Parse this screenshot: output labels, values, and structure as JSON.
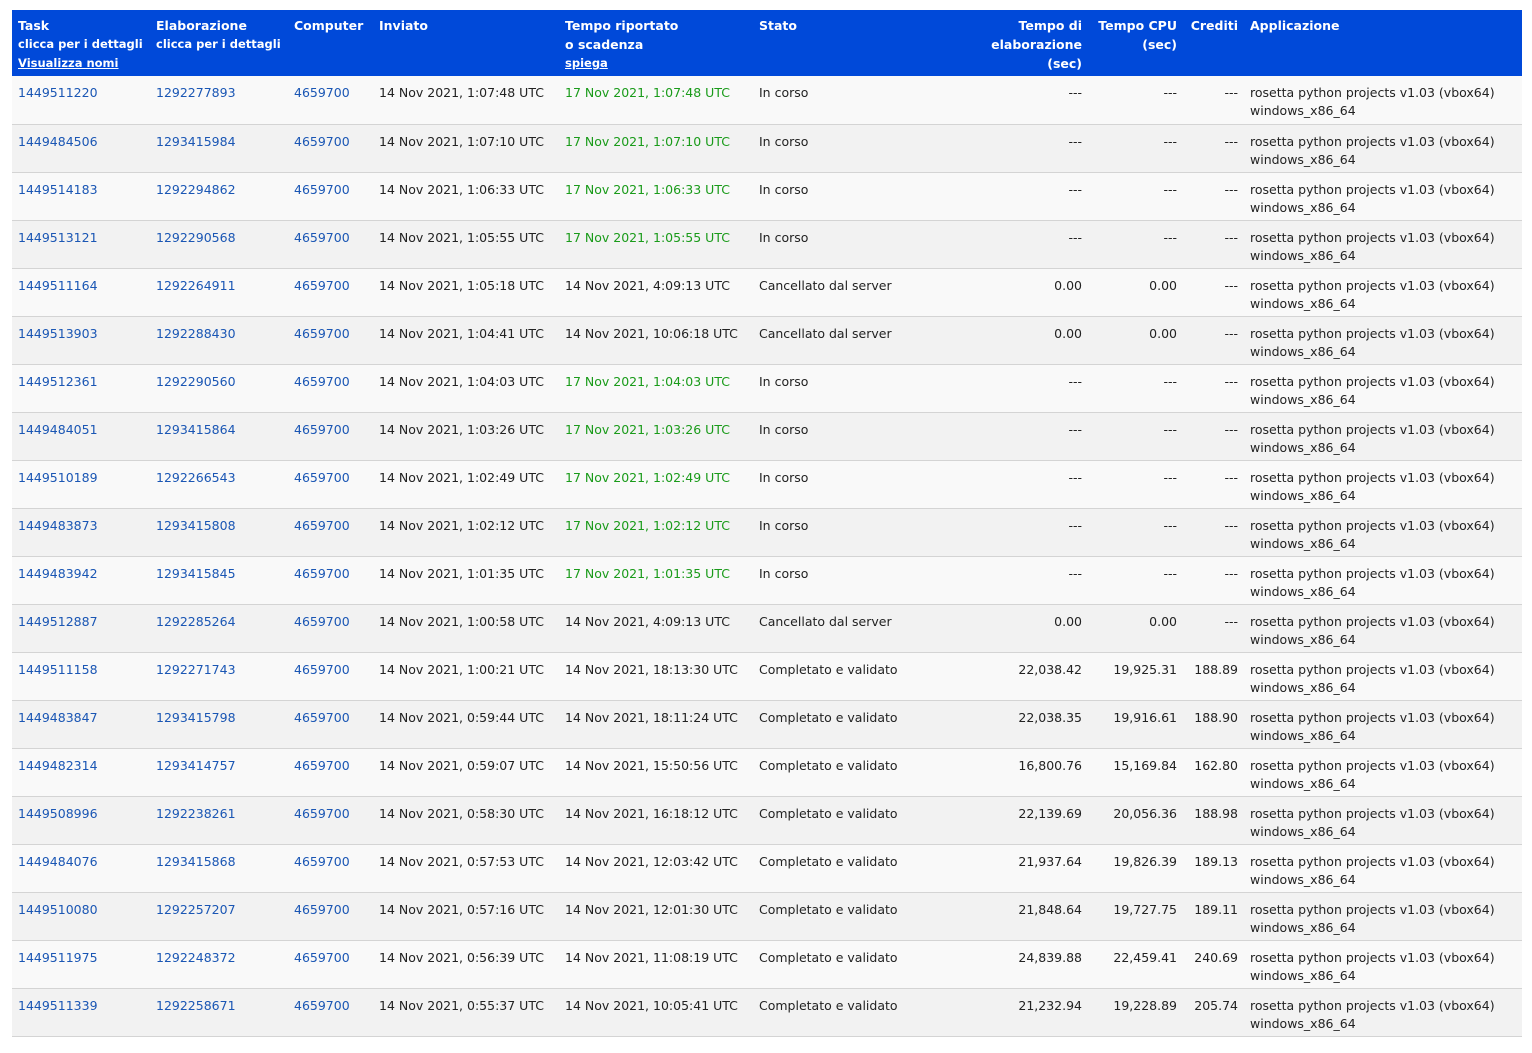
{
  "header": {
    "task": "Task",
    "task_sub": "clicca per i dettagli",
    "task_link": "Visualizza nomi",
    "wu": "Elaborazione",
    "wu_sub": "clicca per i dettagli",
    "computer": "Computer",
    "sent": "Inviato",
    "reported": "Tempo riportato",
    "reported_sub": "o scadenza",
    "reported_link": "spiega",
    "status": "Stato",
    "run_time": "Tempo di elaborazione",
    "run_time_unit": "(sec)",
    "cpu_time": "Tempo CPU",
    "cpu_time_unit": "(sec)",
    "credit": "Crediti",
    "application": "Applicazione"
  },
  "colors": {
    "header_bg": "#0049d9",
    "link": "#1a56b4",
    "in_progress": "#1a9b1a"
  },
  "rows": [
    {
      "task": "1449511220",
      "wu": "1292277893",
      "computer": "4659700",
      "sent": "14 Nov 2021, 1:07:48 UTC",
      "reported": "17 Nov 2021, 1:07:48 UTC",
      "deadline": true,
      "status": "In corso",
      "run": "---",
      "cpu": "---",
      "credit": "---",
      "app": "rosetta python projects v1.03 (vbox64)",
      "platform": "windows_x86_64"
    },
    {
      "task": "1449484506",
      "wu": "1293415984",
      "computer": "4659700",
      "sent": "14 Nov 2021, 1:07:10 UTC",
      "reported": "17 Nov 2021, 1:07:10 UTC",
      "deadline": true,
      "status": "In corso",
      "run": "---",
      "cpu": "---",
      "credit": "---",
      "app": "rosetta python projects v1.03 (vbox64)",
      "platform": "windows_x86_64"
    },
    {
      "task": "1449514183",
      "wu": "1292294862",
      "computer": "4659700",
      "sent": "14 Nov 2021, 1:06:33 UTC",
      "reported": "17 Nov 2021, 1:06:33 UTC",
      "deadline": true,
      "status": "In corso",
      "run": "---",
      "cpu": "---",
      "credit": "---",
      "app": "rosetta python projects v1.03 (vbox64)",
      "platform": "windows_x86_64"
    },
    {
      "task": "1449513121",
      "wu": "1292290568",
      "computer": "4659700",
      "sent": "14 Nov 2021, 1:05:55 UTC",
      "reported": "17 Nov 2021, 1:05:55 UTC",
      "deadline": true,
      "status": "In corso",
      "run": "---",
      "cpu": "---",
      "credit": "---",
      "app": "rosetta python projects v1.03 (vbox64)",
      "platform": "windows_x86_64"
    },
    {
      "task": "1449511164",
      "wu": "1292264911",
      "computer": "4659700",
      "sent": "14 Nov 2021, 1:05:18 UTC",
      "reported": "14 Nov 2021, 4:09:13 UTC",
      "deadline": false,
      "status": "Cancellato dal server",
      "run": "0.00",
      "cpu": "0.00",
      "credit": "---",
      "app": "rosetta python projects v1.03 (vbox64)",
      "platform": "windows_x86_64"
    },
    {
      "task": "1449513903",
      "wu": "1292288430",
      "computer": "4659700",
      "sent": "14 Nov 2021, 1:04:41 UTC",
      "reported": "14 Nov 2021, 10:06:18 UTC",
      "deadline": false,
      "status": "Cancellato dal server",
      "run": "0.00",
      "cpu": "0.00",
      "credit": "---",
      "app": "rosetta python projects v1.03 (vbox64)",
      "platform": "windows_x86_64"
    },
    {
      "task": "1449512361",
      "wu": "1292290560",
      "computer": "4659700",
      "sent": "14 Nov 2021, 1:04:03 UTC",
      "reported": "17 Nov 2021, 1:04:03 UTC",
      "deadline": true,
      "status": "In corso",
      "run": "---",
      "cpu": "---",
      "credit": "---",
      "app": "rosetta python projects v1.03 (vbox64)",
      "platform": "windows_x86_64"
    },
    {
      "task": "1449484051",
      "wu": "1293415864",
      "computer": "4659700",
      "sent": "14 Nov 2021, 1:03:26 UTC",
      "reported": "17 Nov 2021, 1:03:26 UTC",
      "deadline": true,
      "status": "In corso",
      "run": "---",
      "cpu": "---",
      "credit": "---",
      "app": "rosetta python projects v1.03 (vbox64)",
      "platform": "windows_x86_64"
    },
    {
      "task": "1449510189",
      "wu": "1292266543",
      "computer": "4659700",
      "sent": "14 Nov 2021, 1:02:49 UTC",
      "reported": "17 Nov 2021, 1:02:49 UTC",
      "deadline": true,
      "status": "In corso",
      "run": "---",
      "cpu": "---",
      "credit": "---",
      "app": "rosetta python projects v1.03 (vbox64)",
      "platform": "windows_x86_64"
    },
    {
      "task": "1449483873",
      "wu": "1293415808",
      "computer": "4659700",
      "sent": "14 Nov 2021, 1:02:12 UTC",
      "reported": "17 Nov 2021, 1:02:12 UTC",
      "deadline": true,
      "status": "In corso",
      "run": "---",
      "cpu": "---",
      "credit": "---",
      "app": "rosetta python projects v1.03 (vbox64)",
      "platform": "windows_x86_64"
    },
    {
      "task": "1449483942",
      "wu": "1293415845",
      "computer": "4659700",
      "sent": "14 Nov 2021, 1:01:35 UTC",
      "reported": "17 Nov 2021, 1:01:35 UTC",
      "deadline": true,
      "status": "In corso",
      "run": "---",
      "cpu": "---",
      "credit": "---",
      "app": "rosetta python projects v1.03 (vbox64)",
      "platform": "windows_x86_64"
    },
    {
      "task": "1449512887",
      "wu": "1292285264",
      "computer": "4659700",
      "sent": "14 Nov 2021, 1:00:58 UTC",
      "reported": "14 Nov 2021, 4:09:13 UTC",
      "deadline": false,
      "status": "Cancellato dal server",
      "run": "0.00",
      "cpu": "0.00",
      "credit": "---",
      "app": "rosetta python projects v1.03 (vbox64)",
      "platform": "windows_x86_64"
    },
    {
      "task": "1449511158",
      "wu": "1292271743",
      "computer": "4659700",
      "sent": "14 Nov 2021, 1:00:21 UTC",
      "reported": "14 Nov 2021, 18:13:30 UTC",
      "deadline": false,
      "status": "Completato e validato",
      "run": "22,038.42",
      "cpu": "19,925.31",
      "credit": "188.89",
      "app": "rosetta python projects v1.03 (vbox64)",
      "platform": "windows_x86_64"
    },
    {
      "task": "1449483847",
      "wu": "1293415798",
      "computer": "4659700",
      "sent": "14 Nov 2021, 0:59:44 UTC",
      "reported": "14 Nov 2021, 18:11:24 UTC",
      "deadline": false,
      "status": "Completato e validato",
      "run": "22,038.35",
      "cpu": "19,916.61",
      "credit": "188.90",
      "app": "rosetta python projects v1.03 (vbox64)",
      "platform": "windows_x86_64"
    },
    {
      "task": "1449482314",
      "wu": "1293414757",
      "computer": "4659700",
      "sent": "14 Nov 2021, 0:59:07 UTC",
      "reported": "14 Nov 2021, 15:50:56 UTC",
      "deadline": false,
      "status": "Completato e validato",
      "run": "16,800.76",
      "cpu": "15,169.84",
      "credit": "162.80",
      "app": "rosetta python projects v1.03 (vbox64)",
      "platform": "windows_x86_64"
    },
    {
      "task": "1449508996",
      "wu": "1292238261",
      "computer": "4659700",
      "sent": "14 Nov 2021, 0:58:30 UTC",
      "reported": "14 Nov 2021, 16:18:12 UTC",
      "deadline": false,
      "status": "Completato e validato",
      "run": "22,139.69",
      "cpu": "20,056.36",
      "credit": "188.98",
      "app": "rosetta python projects v1.03 (vbox64)",
      "platform": "windows_x86_64"
    },
    {
      "task": "1449484076",
      "wu": "1293415868",
      "computer": "4659700",
      "sent": "14 Nov 2021, 0:57:53 UTC",
      "reported": "14 Nov 2021, 12:03:42 UTC",
      "deadline": false,
      "status": "Completato e validato",
      "run": "21,937.64",
      "cpu": "19,826.39",
      "credit": "189.13",
      "app": "rosetta python projects v1.03 (vbox64)",
      "platform": "windows_x86_64"
    },
    {
      "task": "1449510080",
      "wu": "1292257207",
      "computer": "4659700",
      "sent": "14 Nov 2021, 0:57:16 UTC",
      "reported": "14 Nov 2021, 12:01:30 UTC",
      "deadline": false,
      "status": "Completato e validato",
      "run": "21,848.64",
      "cpu": "19,727.75",
      "credit": "189.11",
      "app": "rosetta python projects v1.03 (vbox64)",
      "platform": "windows_x86_64"
    },
    {
      "task": "1449511975",
      "wu": "1292248372",
      "computer": "4659700",
      "sent": "14 Nov 2021, 0:56:39 UTC",
      "reported": "14 Nov 2021, 11:08:19 UTC",
      "deadline": false,
      "status": "Completato e validato",
      "run": "24,839.88",
      "cpu": "22,459.41",
      "credit": "240.69",
      "app": "rosetta python projects v1.03 (vbox64)",
      "platform": "windows_x86_64"
    },
    {
      "task": "1449511339",
      "wu": "1292258671",
      "computer": "4659700",
      "sent": "14 Nov 2021, 0:55:37 UTC",
      "reported": "14 Nov 2021, 10:05:41 UTC",
      "deadline": false,
      "status": "Completato e validato",
      "run": "21,232.94",
      "cpu": "19,228.89",
      "credit": "205.74",
      "app": "rosetta python projects v1.03 (vbox64)",
      "platform": "windows_x86_64"
    }
  ]
}
